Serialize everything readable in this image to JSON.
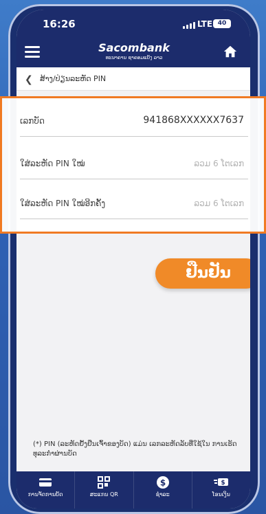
{
  "status": {
    "time": "16:26",
    "network": "LTE",
    "battery": "40"
  },
  "header": {
    "logo_main": "Sacombank",
    "logo_sub": "ທະນາຄານ ຊາຄອມແບັງ ລາວ"
  },
  "breadcrumb": {
    "title": "ສ້າງ/ປ່ຽນລະຫັດ PIN"
  },
  "form": {
    "card_number": {
      "label": "ເລກບັດ",
      "value": "941868XXXXXX7637"
    },
    "new_pin": {
      "label": "ໃສ່ລະຫັດ PIN ໃໝ່",
      "placeholder": "ລວມ 6 ໂຕເລກ"
    },
    "confirm_pin": {
      "label": "ໃສ່ລະຫັດ PIN ໃໝ່ອີກຄັ້ງ",
      "placeholder": "ລວມ 6 ໂຕເລກ"
    }
  },
  "confirm_label": "ຢືນຢັນ",
  "note": "(*) PIN (ລະຫັດຢັ້ງຢືນເຈົ້າຂອງບັດ) ແມ່ນ ເລກລະຫັດລັບທີ່ໃຊ້ໃນ ການເຮັດທຸລະກຳຜ່ານບັດ",
  "bottom_nav": [
    {
      "icon": "card-icon",
      "label": "ການຈັດການບັດ"
    },
    {
      "icon": "qr-icon",
      "label": "ສະແກນ QR"
    },
    {
      "icon": "payment-icon",
      "label": "ຊຳລະ"
    },
    {
      "icon": "transfer-icon",
      "label": "ໂອນເງິນ"
    }
  ],
  "colors": {
    "brand": "#1c2c6c",
    "accent": "#f08a28"
  }
}
